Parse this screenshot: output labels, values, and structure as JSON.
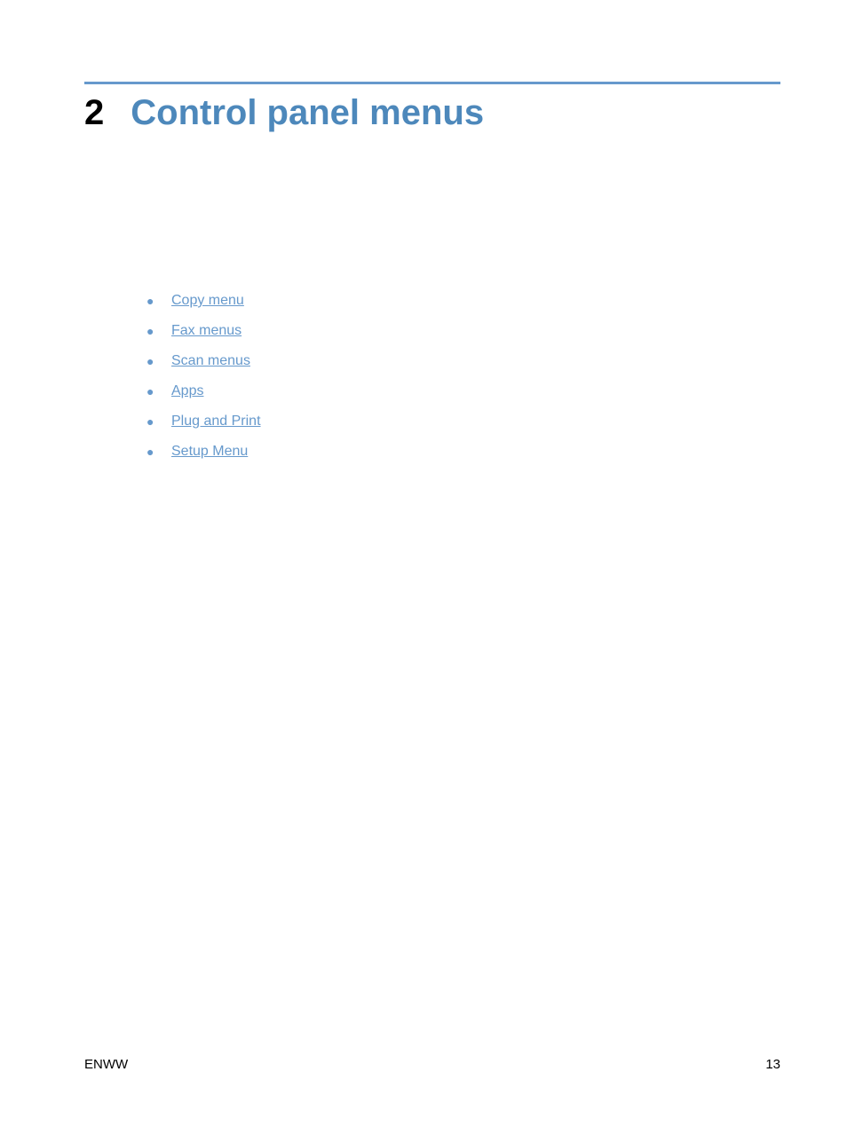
{
  "chapter": {
    "number": "2",
    "title": "Control panel menus"
  },
  "toc": {
    "items": [
      {
        "label": "Copy menu"
      },
      {
        "label": "Fax menus"
      },
      {
        "label": "Scan menus"
      },
      {
        "label": "Apps"
      },
      {
        "label": "Plug and Print"
      },
      {
        "label": "Setup Menu"
      }
    ]
  },
  "footer": {
    "left": "ENWW",
    "right": "13"
  }
}
